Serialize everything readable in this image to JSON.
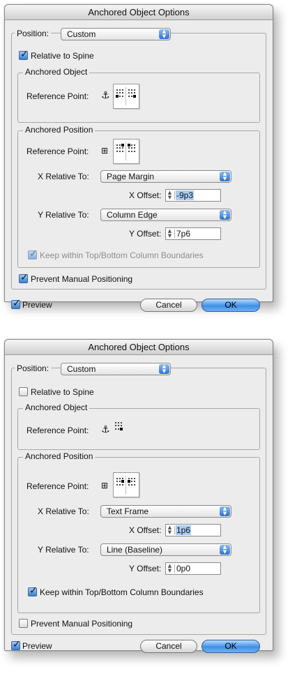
{
  "dialogs": [
    {
      "title": "Anchored Object Options",
      "position_label": "Position:",
      "position_value": "Custom",
      "relative_to_spine_label": "Relative to Spine",
      "relative_to_spine_checked": true,
      "anchored_object_group": "Anchored Object",
      "anchored_object_ref_label": "Reference Point:",
      "anchored_position_group": "Anchored Position",
      "anchored_position_ref_label": "Reference Point:",
      "x_relative_label": "X Relative To:",
      "x_relative_value": "Page Margin",
      "x_offset_label": "X Offset:",
      "x_offset_value": "-9p3",
      "y_relative_label": "Y Relative To:",
      "y_relative_value": "Column Edge",
      "y_offset_label": "Y Offset:",
      "y_offset_value": "7p6",
      "keep_within_label": "Keep within Top/Bottom Column Boundaries",
      "keep_within_checked": true,
      "keep_within_enabled": false,
      "prevent_label": "Prevent Manual Positioning",
      "prevent_checked": true,
      "preview_label": "Preview",
      "preview_checked": true,
      "cancel_label": "Cancel",
      "ok_label": "OK"
    },
    {
      "title": "Anchored Object Options",
      "position_label": "Position:",
      "position_value": "Custom",
      "relative_to_spine_label": "Relative to Spine",
      "relative_to_spine_checked": false,
      "anchored_object_group": "Anchored Object",
      "anchored_object_ref_label": "Reference Point:",
      "anchored_position_group": "Anchored Position",
      "anchored_position_ref_label": "Reference Point:",
      "x_relative_label": "X Relative To:",
      "x_relative_value": "Text Frame",
      "x_offset_label": "X Offset:",
      "x_offset_value": "1p6",
      "y_relative_label": "Y Relative To:",
      "y_relative_value": "Line (Baseline)",
      "y_offset_label": "Y Offset:",
      "y_offset_value": "0p0",
      "keep_within_label": "Keep within Top/Bottom Column Boundaries",
      "keep_within_checked": true,
      "keep_within_enabled": true,
      "prevent_label": "Prevent Manual Positioning",
      "prevent_checked": false,
      "preview_label": "Preview",
      "preview_checked": true,
      "cancel_label": "Cancel",
      "ok_label": "OK"
    }
  ],
  "icons": {
    "anchor": "anchor-icon",
    "reference_point": "reference-point-proxy-icon",
    "popup_arrow": "popup-arrows-icon",
    "stepper": "stepper-arrows-icon"
  },
  "colors": {
    "dialog_bg": "#ececec",
    "ok_button": "#3f8fe6",
    "selection": "#a9cdf4"
  }
}
